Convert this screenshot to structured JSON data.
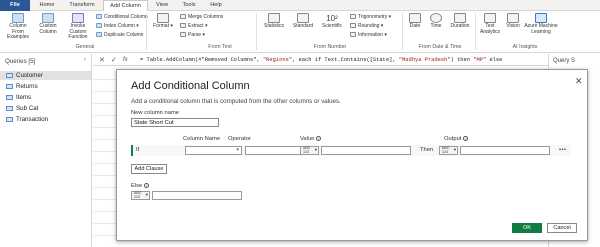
{
  "tabs": [
    "File",
    "Home",
    "Transform",
    "Add Column",
    "View",
    "Tools",
    "Help"
  ],
  "ribbon": {
    "general": {
      "column_from_examples": "Column From Examples",
      "custom_column": "Custom Column",
      "invoke_custom_function": "Invoke Custom Function",
      "conditional_column": "Conditional Column",
      "index_column": "Index Column",
      "duplicate_column": "Duplicate Column",
      "label": "General"
    },
    "from_text": {
      "format": "Format",
      "merge_columns": "Merge Columns",
      "extract": "Extract",
      "parse": "Parse",
      "label": "From Text"
    },
    "from_number": {
      "statistics": "Statistics",
      "standard": "Standard",
      "scientific": "Scientific",
      "scientific_glyph": "10²",
      "trigonometry": "Trigonometry",
      "rounding": "Rounding",
      "information": "Information",
      "label": "From Number"
    },
    "from_date_time": {
      "date": "Date",
      "time": "Time",
      "duration": "Duration",
      "label": "From Date & Time"
    },
    "ai_insights": {
      "text_analytics": "Text Analytics",
      "vision": "Vision",
      "azure_ml": "Azure Machine Learning",
      "label": "AI Insights"
    }
  },
  "queries": {
    "title": "Queries [5]",
    "items": [
      "Customer",
      "Returns",
      "Items",
      "Sub Cat",
      "Transaction"
    ],
    "selected_index": 0
  },
  "formula": {
    "cancel_symbol": "✕",
    "commit_symbol": "✓",
    "fx": "fx",
    "text_prefix": "= Table.AddColumn(#\"Removed Columns\", ",
    "text_str1": "\"Regions\"",
    "text_mid": ", each if Text.Contains([State], ",
    "text_str2": "\"Madhya Pradesh\"",
    "text_mid2": ") then ",
    "text_str3": "\"MP\"",
    "text_suffix": " else"
  },
  "settings": {
    "title": "Query S"
  },
  "dialog": {
    "title": "Add Conditional Column",
    "close": "✕",
    "description": "Add a conditional column that is computed from the other columns or values.",
    "new_column_label": "New column name",
    "new_column_value": "State Short Cut",
    "headers": {
      "column_name": "Column Name",
      "operator": "Operator",
      "value": "Value",
      "output": "Output"
    },
    "info_symbol": "i",
    "if_label": "If",
    "then_label": "Then",
    "type_label": "ABC\n123",
    "more": "•••",
    "add_clause": "Add Clause",
    "else_label": "Else",
    "ok": "OK",
    "cancel": "Cancel"
  },
  "colors": {
    "file_tab": "#2b5797",
    "accent_green": "#107c41",
    "selected_query": "#e1e1e1"
  }
}
